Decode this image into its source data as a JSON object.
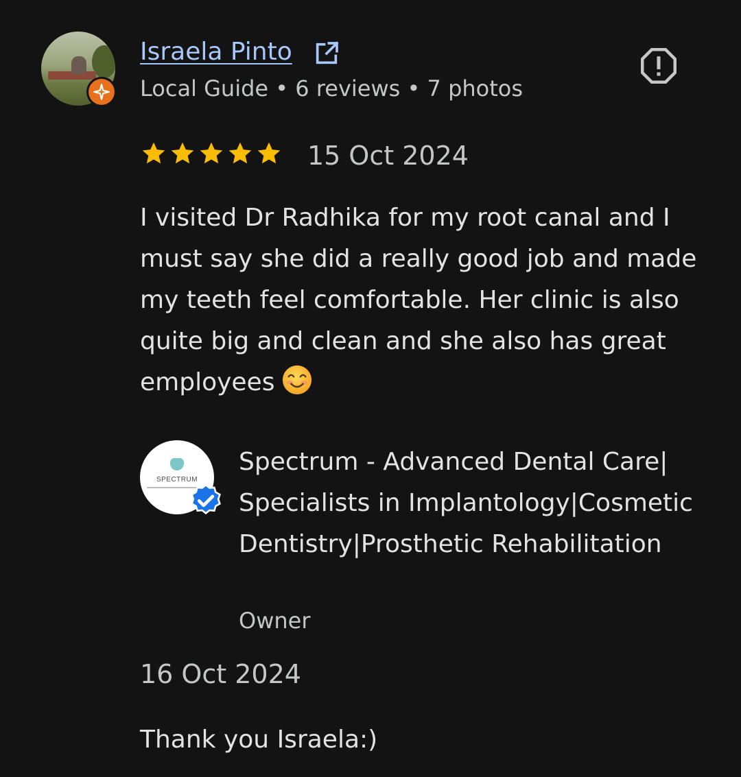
{
  "review": {
    "reviewer_name": "Israela Pinto",
    "reviewer_meta": "Local Guide • 6 reviews • 7 photos",
    "rating": 5,
    "rating_max": 5,
    "date": "15 Oct 2024",
    "text": "I visited Dr Radhika for my root canal and I must say she did a really good job and made my teeth feel comfortable. Her clinic is also quite big and clean and she also has great employees",
    "icons": {
      "open": "open-in-new-icon",
      "report": "report-flag-icon",
      "badge": "local-guide-badge-icon",
      "star": "star-icon",
      "emoji": "smiling-face-emoji"
    }
  },
  "owner_response": {
    "logo_text": "SPECTRUM",
    "business_name": "Spectrum - Advanced Dental Care| Specialists in Implantology|Cosmetic Dentistry|Prosthetic Rehabilitation",
    "role": "Owner",
    "date": "16 Oct 2024",
    "text": "Thank you Israela:)",
    "icons": {
      "verified": "verified-badge-icon"
    }
  },
  "colors": {
    "background": "#131314",
    "link": "#a8c7fa",
    "star": "#fbbc04",
    "guide_badge": "#e8711e",
    "verified": "#1a73e8"
  }
}
